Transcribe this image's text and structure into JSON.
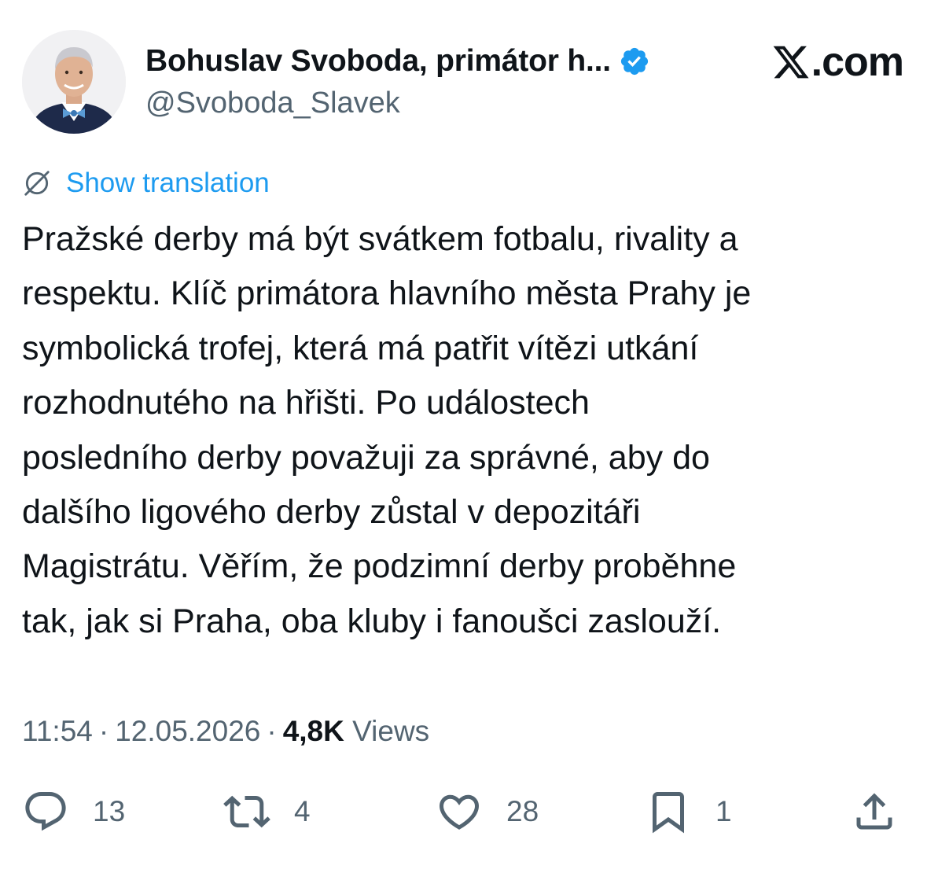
{
  "header": {
    "display_name": "Bohuslav Svoboda, primátor h...",
    "handle": "@Svoboda_Slavek",
    "site_label": ".com",
    "verified_icon": "verified-badge-icon",
    "site_logo_icon": "x-logo-icon"
  },
  "translation": {
    "label": "Show translation",
    "icon": "globe-icon"
  },
  "tweet": {
    "lines": [
      "Pražské derby má být svátkem fotbalu, rivality a",
      "respektu. Klíč primátora hlavního města Prahy je",
      "symbolická trofej, která má patřit vítězi utkání",
      "rozhodnutého na hřišti. Po událostech",
      "posledního derby považuji za správné, aby do",
      "dalšího ligového derby zůstal v depozitáři",
      "Magistrátu. Věřím, že podzimní derby proběhne",
      "tak, jak si Praha, oba kluby i fanoušci zaslouží."
    ]
  },
  "meta": {
    "time": "11:54",
    "separator": "·",
    "date": "12.05.2026",
    "views_count": "4,8K",
    "views_label": "Views"
  },
  "actions": {
    "replies": {
      "icon": "reply-icon",
      "count": "13"
    },
    "reposts": {
      "icon": "repost-icon",
      "count": "4"
    },
    "likes": {
      "icon": "like-icon",
      "count": "28"
    },
    "bookmarks": {
      "icon": "bookmark-icon",
      "count": "1"
    },
    "share": {
      "icon": "share-icon"
    }
  },
  "colors": {
    "text": "#0f1419",
    "secondary": "#536471",
    "link": "#1d9bf0",
    "verified": "#1d9bf0"
  }
}
